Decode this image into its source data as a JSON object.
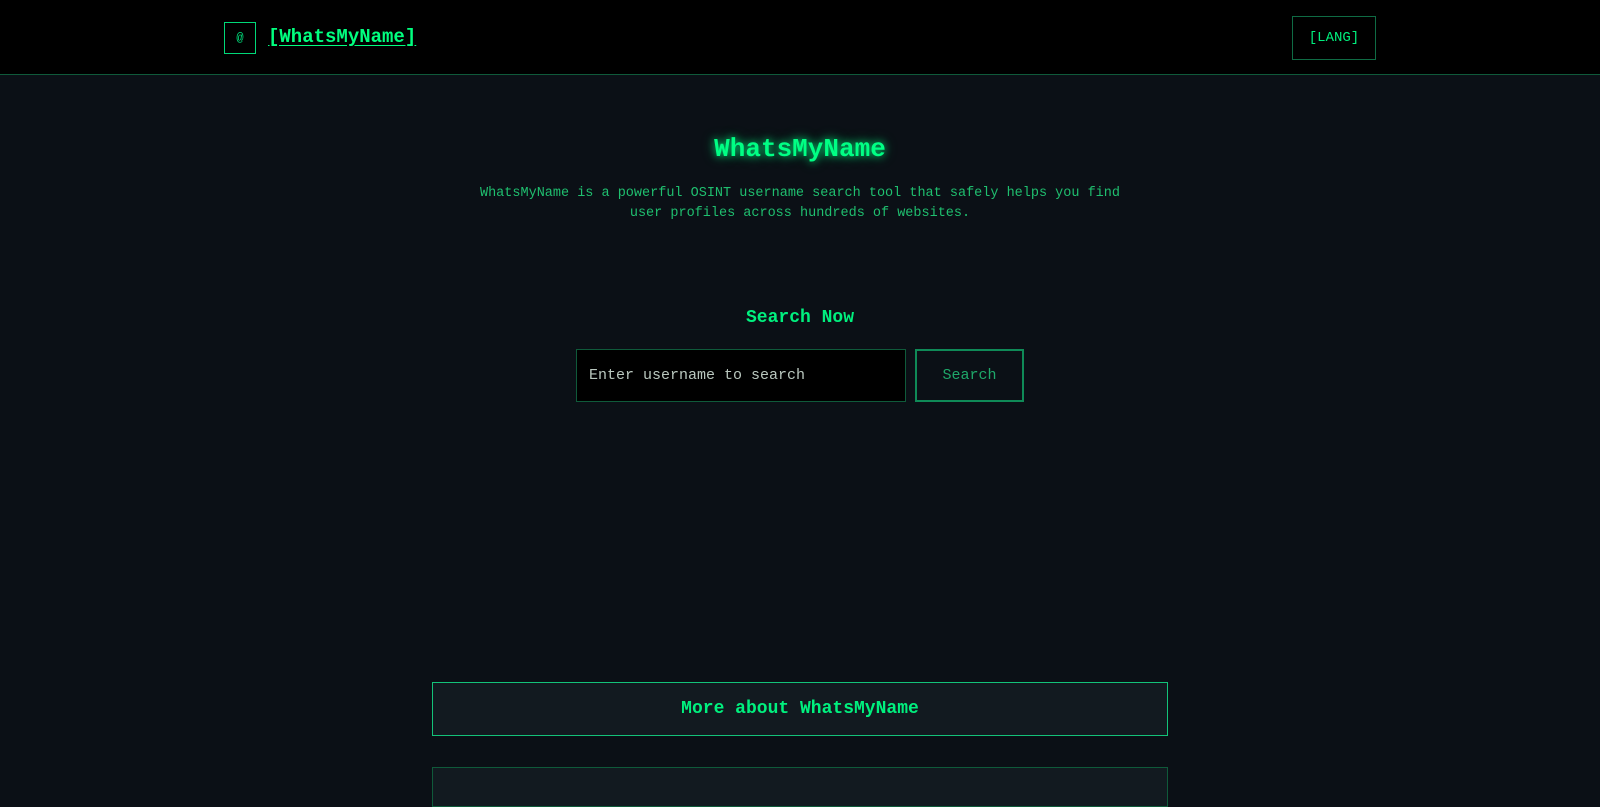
{
  "header": {
    "logo_icon": "@",
    "brand": "[WhatsMyName]",
    "lang_button": "[LANG]"
  },
  "hero": {
    "title": "WhatsMyName",
    "description": "WhatsMyName is a powerful OSINT username search tool that safely helps you find user profiles across hundreds of websites."
  },
  "search": {
    "heading": "Search Now",
    "placeholder": "Enter username to search",
    "value": "",
    "button_label": "Search"
  },
  "sections": {
    "more_about": "More about WhatsMyName"
  },
  "colors": {
    "background": "#0b1016",
    "topbar": "#000000",
    "accent": "#00ff7f",
    "border": "#0f5a3a"
  }
}
